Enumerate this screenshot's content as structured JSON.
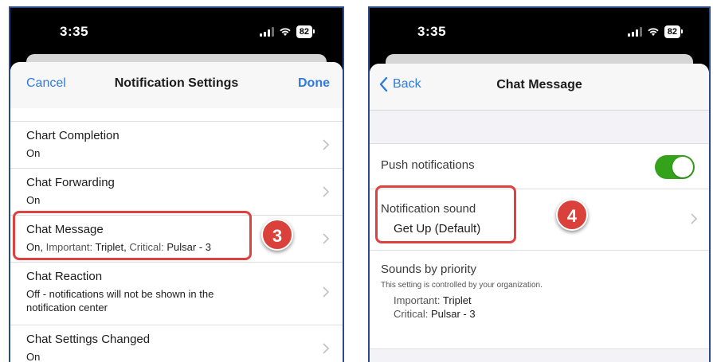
{
  "left_phone": {
    "status": {
      "time": "3:35",
      "battery": "82"
    },
    "nav": {
      "cancel": "Cancel",
      "title": "Notification Settings",
      "done": "Done"
    },
    "rows": [
      {
        "label": "Chart Completion",
        "value": "On"
      },
      {
        "label": "Chat Forwarding",
        "value": "On"
      },
      {
        "label": "Chat Message",
        "value_on": "On,",
        "value_imp_key": "Important:",
        "value_imp": "Triplet,",
        "value_crit_key": "Critical:",
        "value_crit": "Pulsar - 3"
      },
      {
        "label": "Chat Reaction",
        "value": "Off - notifications will not be shown in the notification center"
      },
      {
        "label": "Chat Settings Changed",
        "value": "On"
      }
    ],
    "step_badge": "3"
  },
  "right_phone": {
    "status": {
      "time": "3:35",
      "battery": "82"
    },
    "nav": {
      "back": "Back",
      "title": "Chat Message"
    },
    "push": {
      "label": "Push notifications",
      "enabled": true
    },
    "sound": {
      "label": "Notification sound",
      "value": "Get Up (Default)"
    },
    "priority": {
      "label": "Sounds by priority",
      "note": "This setting is controlled by your organization.",
      "important_key": "Important:",
      "important": "Triplet",
      "critical_key": "Critical:",
      "critical": "Pulsar - 3"
    },
    "step_badge": "4"
  },
  "colors": {
    "accent": "#2f7be0",
    "highlight": "#e04040",
    "badge": "#d9413a",
    "toggle_on": "#34a31b"
  }
}
